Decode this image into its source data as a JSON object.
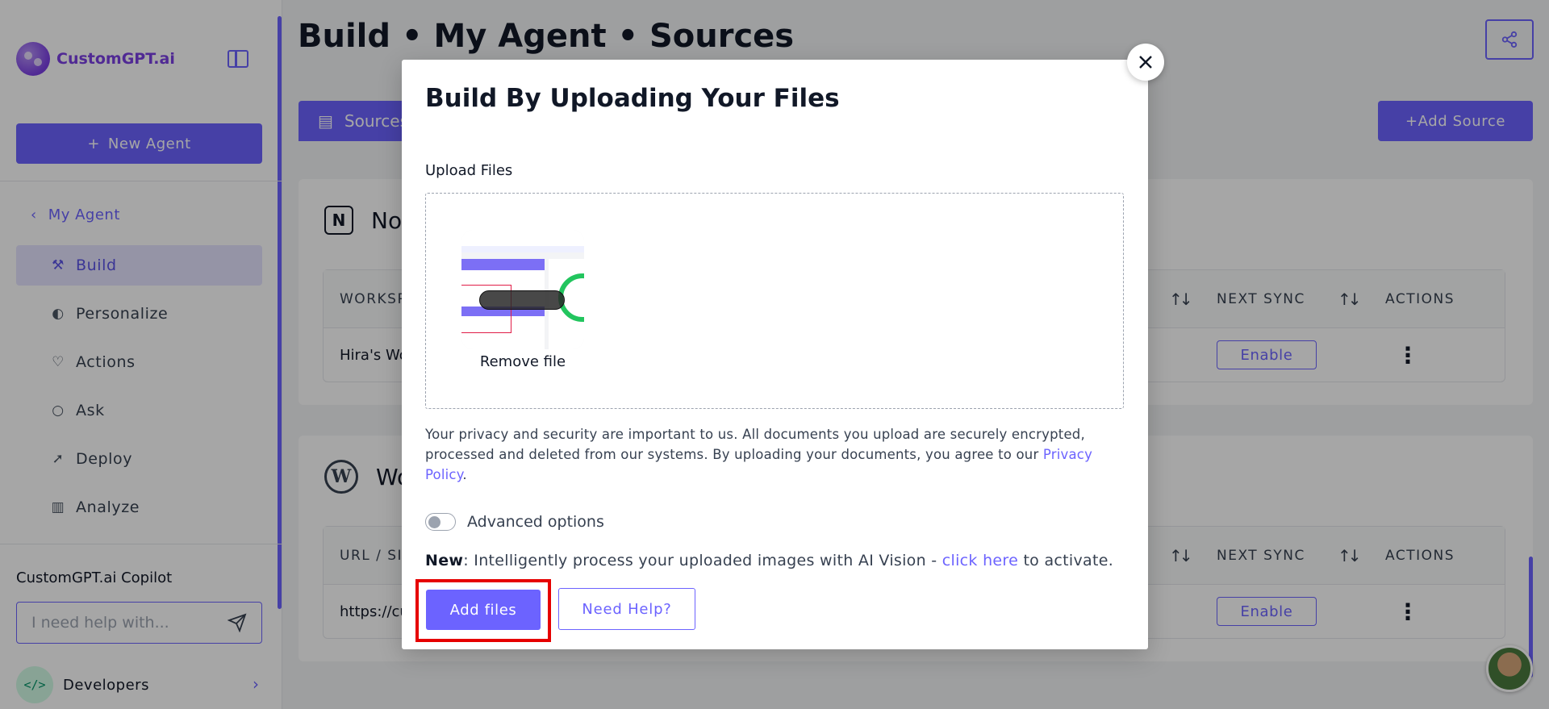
{
  "brand": {
    "name": "CustomGPT.ai",
    "accent": "#6c63ff",
    "highlight": "#e60000"
  },
  "sidebar": {
    "new_agent": "New Agent",
    "back_label": "My Agent",
    "items": [
      {
        "label": "Build",
        "icon": "build-icon",
        "active": true
      },
      {
        "label": "Personalize",
        "icon": "palette-icon",
        "active": false
      },
      {
        "label": "Actions",
        "icon": "heart-icon",
        "active": false
      },
      {
        "label": "Ask",
        "icon": "chat-bubble-icon",
        "active": false
      },
      {
        "label": "Deploy",
        "icon": "rocket-icon",
        "active": false
      },
      {
        "label": "Analyze",
        "icon": "bar-chart-icon",
        "active": false
      }
    ],
    "copilot_title": "CustomGPT.ai Copilot",
    "copilot_placeholder": "I need help with...",
    "developers": "Developers"
  },
  "header": {
    "title": "Build • My Agent • Sources"
  },
  "tabs": {
    "sources": "Sources"
  },
  "add_source": "Add Source",
  "sections": {
    "notion": {
      "title": "No",
      "columns": {
        "workspace": "WORKSP",
        "next_sync": "NEXT SYNC",
        "actions": "ACTIONS"
      },
      "row": {
        "workspace": "Hira's Wo",
        "enable": "Enable"
      }
    },
    "wordpress": {
      "title": "Wo",
      "columns": {
        "url": "URL / SIT",
        "next_sync": "NEXT SYNC",
        "actions": "ACTIONS"
      },
      "row": {
        "url": "https://cu",
        "enable": "Enable"
      }
    }
  },
  "modal": {
    "title": "Build By Uploading Your Files",
    "upload_label": "Upload Files",
    "remove_file": "Remove file",
    "privacy_text": "Your privacy and security are important to us. All documents you upload are securely encrypted, processed and deleted from our systems. By uploading your documents, you agree to our",
    "privacy_link": "Privacy Policy",
    "privacy_end": ".",
    "advanced_options": "Advanced options",
    "vision_new": "New",
    "vision_text": ": Intelligently process your uploaded images with AI Vision -",
    "vision_link": "click here",
    "vision_end": "to activate.",
    "add_files": "Add files",
    "need_help": "Need Help?"
  }
}
